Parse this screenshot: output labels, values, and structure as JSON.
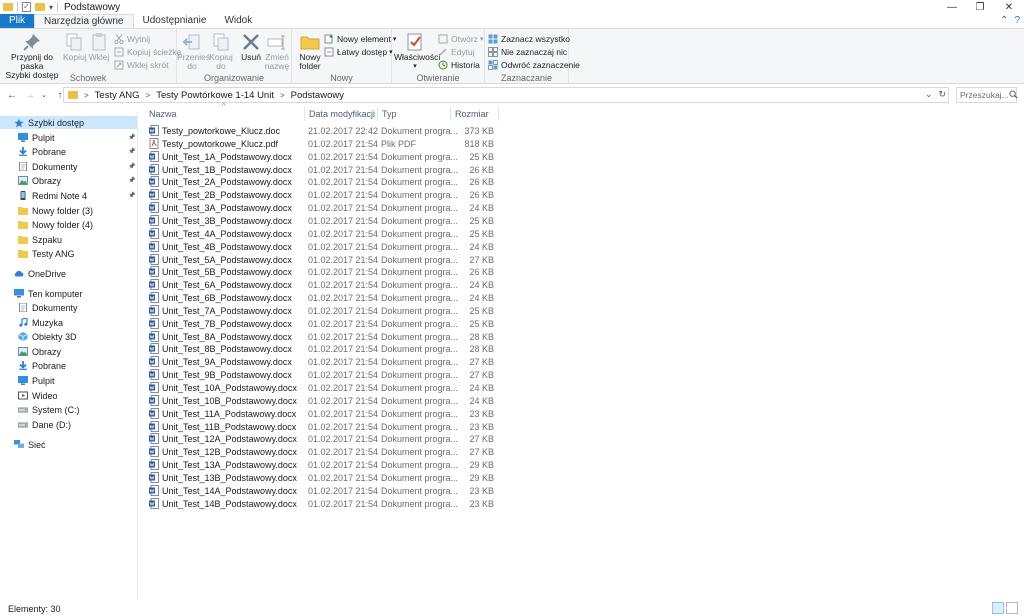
{
  "window": {
    "title": "Podstawowy",
    "minimize": "—",
    "restore": "❐",
    "close": "✕"
  },
  "tabs": [
    {
      "label": "Plik"
    },
    {
      "label": "Narzędzia główne"
    },
    {
      "label": "Udostępnianie"
    },
    {
      "label": "Widok"
    }
  ],
  "ribbon": {
    "schowek": {
      "label": "Schowek",
      "pin_line1": "Przypnij do paska",
      "pin_line2": "Szybki dostęp",
      "copy": "Kopiuj",
      "paste": "Wklej",
      "cut": "Wytnij",
      "copy_path": "Kopiuj ścieżkę",
      "paste_shortcut": "Wklej skrót"
    },
    "organizowanie": {
      "label": "Organizowanie",
      "move_line1": "Przenieś",
      "move_line2": "do",
      "copyto_line1": "Kopiuj",
      "copyto_line2": "do",
      "delete": "Usuń",
      "rename_line1": "Zmień",
      "rename_line2": "nazwę"
    },
    "nowy": {
      "label": "Nowy",
      "folder_line1": "Nowy",
      "folder_line2": "folder",
      "new_item": "Nowy element",
      "easy_access": "Łatwy dostęp"
    },
    "otwieranie": {
      "label": "Otwieranie",
      "properties": "Właściwości",
      "open": "Otwórz",
      "edit": "Edytuj",
      "history": "Historia"
    },
    "zaznaczanie": {
      "label": "Zaznaczanie",
      "select_all": "Zaznacz wszystko",
      "select_none": "Nie zaznaczaj nic",
      "invert": "Odwróć zaznaczenie"
    }
  },
  "address": {
    "crumbs": [
      "Testy ANG",
      "Testy Powtórkowe 1-14 Unit",
      "Podstawowy"
    ],
    "search_placeholder": "Przeszukaj..."
  },
  "nav": [
    {
      "label": "Szybki dostęp",
      "icon": "star-icon",
      "pinned": false
    },
    {
      "label": "Pulpit",
      "icon": "desktop-icon",
      "pinned": true
    },
    {
      "label": "Pobrane",
      "icon": "download-icon",
      "pinned": true
    },
    {
      "label": "Dokumenty",
      "icon": "documents-icon",
      "pinned": true
    },
    {
      "label": "Obrazy",
      "icon": "pictures-icon",
      "pinned": true
    },
    {
      "label": "Redmi Note 4",
      "icon": "phone-icon",
      "pinned": true
    },
    {
      "label": "Nowy folder (3)",
      "icon": "folder-icon",
      "pinned": false
    },
    {
      "label": "Nowy folder (4)",
      "icon": "folder-icon",
      "pinned": false
    },
    {
      "label": "Szpaku",
      "icon": "folder-icon",
      "pinned": false
    },
    {
      "label": "Testy ANG",
      "icon": "folder-icon",
      "pinned": false
    },
    {
      "label": "OneDrive",
      "icon": "cloud-icon",
      "pinned": false
    },
    {
      "label": "Ten komputer",
      "icon": "computer-icon",
      "pinned": false
    },
    {
      "label": "Dokumenty",
      "icon": "documents-icon",
      "pinned": false
    },
    {
      "label": "Muzyka",
      "icon": "music-icon",
      "pinned": false
    },
    {
      "label": "Obiekty 3D",
      "icon": "cube-icon",
      "pinned": false
    },
    {
      "label": "Obrazy",
      "icon": "pictures-icon",
      "pinned": false
    },
    {
      "label": "Pobrane",
      "icon": "download-icon",
      "pinned": false
    },
    {
      "label": "Pulpit",
      "icon": "desktop-icon",
      "pinned": false
    },
    {
      "label": "Wideo",
      "icon": "video-icon",
      "pinned": false
    },
    {
      "label": "System (C:)",
      "icon": "drive-icon",
      "pinned": false
    },
    {
      "label": "Dane (D:)",
      "icon": "drive-icon",
      "pinned": false
    },
    {
      "label": "Sieć",
      "icon": "network-icon",
      "pinned": false
    }
  ],
  "columns": {
    "name": "Nazwa",
    "date": "Data modyfikacji",
    "type": "Typ",
    "size": "Rozmiar"
  },
  "files": [
    {
      "name": "Testy_powtorkowe_Klucz.doc",
      "date": "21.02.2017 22:42",
      "type": "Dokument progra...",
      "size": "373 KB",
      "icon": "word-icon"
    },
    {
      "name": "Testy_powtorkowe_Klucz.pdf",
      "date": "01.02.2017 21:54",
      "type": "Plik PDF",
      "size": "818 KB",
      "icon": "pdf-icon"
    },
    {
      "name": "Unit_Test_1A_Podstawowy.docx",
      "date": "01.02.2017 21:54",
      "type": "Dokument progra...",
      "size": "25 KB",
      "icon": "word-icon"
    },
    {
      "name": "Unit_Test_1B_Podstawowy.docx",
      "date": "01.02.2017 21:54",
      "type": "Dokument progra...",
      "size": "26 KB",
      "icon": "word-icon"
    },
    {
      "name": "Unit_Test_2A_Podstawowy.docx",
      "date": "01.02.2017 21:54",
      "type": "Dokument progra...",
      "size": "26 KB",
      "icon": "word-icon"
    },
    {
      "name": "Unit_Test_2B_Podstawowy.docx",
      "date": "01.02.2017 21:54",
      "type": "Dokument progra...",
      "size": "26 KB",
      "icon": "word-icon"
    },
    {
      "name": "Unit_Test_3A_Podstawowy.docx",
      "date": "01.02.2017 21:54",
      "type": "Dokument progra...",
      "size": "24 KB",
      "icon": "word-icon"
    },
    {
      "name": "Unit_Test_3B_Podstawowy.docx",
      "date": "01.02.2017 21:54",
      "type": "Dokument progra...",
      "size": "25 KB",
      "icon": "word-icon"
    },
    {
      "name": "Unit_Test_4A_Podstawowy.docx",
      "date": "01.02.2017 21:54",
      "type": "Dokument progra...",
      "size": "25 KB",
      "icon": "word-icon"
    },
    {
      "name": "Unit_Test_4B_Podstawowy.docx",
      "date": "01.02.2017 21:54",
      "type": "Dokument progra...",
      "size": "24 KB",
      "icon": "word-icon"
    },
    {
      "name": "Unit_Test_5A_Podstawowy.docx",
      "date": "01.02.2017 21:54",
      "type": "Dokument progra...",
      "size": "27 KB",
      "icon": "word-icon"
    },
    {
      "name": "Unit_Test_5B_Podstawowy.docx",
      "date": "01.02.2017 21:54",
      "type": "Dokument progra...",
      "size": "26 KB",
      "icon": "word-icon"
    },
    {
      "name": "Unit_Test_6A_Podstawowy.docx",
      "date": "01.02.2017 21:54",
      "type": "Dokument progra...",
      "size": "24 KB",
      "icon": "word-icon"
    },
    {
      "name": "Unit_Test_6B_Podstawowy.docx",
      "date": "01.02.2017 21:54",
      "type": "Dokument progra...",
      "size": "24 KB",
      "icon": "word-icon"
    },
    {
      "name": "Unit_Test_7A_Podstawowy.docx",
      "date": "01.02.2017 21:54",
      "type": "Dokument progra...",
      "size": "25 KB",
      "icon": "word-icon"
    },
    {
      "name": "Unit_Test_7B_Podstawowy.docx",
      "date": "01.02.2017 21:54",
      "type": "Dokument progra...",
      "size": "25 KB",
      "icon": "word-icon"
    },
    {
      "name": "Unit_Test_8A_Podstawowy.docx",
      "date": "01.02.2017 21:54",
      "type": "Dokument progra...",
      "size": "28 KB",
      "icon": "word-icon"
    },
    {
      "name": "Unit_Test_8B_Podstawowy.docx",
      "date": "01.02.2017 21:54",
      "type": "Dokument progra...",
      "size": "28 KB",
      "icon": "word-icon"
    },
    {
      "name": "Unit_Test_9A_Podstawowy.docx",
      "date": "01.02.2017 21:54",
      "type": "Dokument progra...",
      "size": "27 KB",
      "icon": "word-icon"
    },
    {
      "name": "Unit_Test_9B_Podstawowy.docx",
      "date": "01.02.2017 21:54",
      "type": "Dokument progra...",
      "size": "27 KB",
      "icon": "word-icon"
    },
    {
      "name": "Unit_Test_10A_Podstawowy.docx",
      "date": "01.02.2017 21:54",
      "type": "Dokument progra...",
      "size": "24 KB",
      "icon": "word-icon"
    },
    {
      "name": "Unit_Test_10B_Podstawowy.docx",
      "date": "01.02.2017 21:54",
      "type": "Dokument progra...",
      "size": "24 KB",
      "icon": "word-icon"
    },
    {
      "name": "Unit_Test_11A_Podstawowy.docx",
      "date": "01.02.2017 21:54",
      "type": "Dokument progra...",
      "size": "23 KB",
      "icon": "word-icon"
    },
    {
      "name": "Unit_Test_11B_Podstawowy.docx",
      "date": "01.02.2017 21:54",
      "type": "Dokument progra...",
      "size": "23 KB",
      "icon": "word-icon"
    },
    {
      "name": "Unit_Test_12A_Podstawowy.docx",
      "date": "01.02.2017 21:54",
      "type": "Dokument progra...",
      "size": "27 KB",
      "icon": "word-icon"
    },
    {
      "name": "Unit_Test_12B_Podstawowy.docx",
      "date": "01.02.2017 21:54",
      "type": "Dokument progra...",
      "size": "27 KB",
      "icon": "word-icon"
    },
    {
      "name": "Unit_Test_13A_Podstawowy.docx",
      "date": "01.02.2017 21:54",
      "type": "Dokument progra...",
      "size": "29 KB",
      "icon": "word-icon"
    },
    {
      "name": "Unit_Test_13B_Podstawowy.docx",
      "date": "01.02.2017 21:54",
      "type": "Dokument progra...",
      "size": "29 KB",
      "icon": "word-icon"
    },
    {
      "name": "Unit_Test_14A_Podstawowy.docx",
      "date": "01.02.2017 21:54",
      "type": "Dokument progra...",
      "size": "23 KB",
      "icon": "word-icon"
    },
    {
      "name": "Unit_Test_14B_Podstawowy.docx",
      "date": "01.02.2017 21:54",
      "type": "Dokument progra...",
      "size": "23 KB",
      "icon": "word-icon"
    }
  ],
  "status": {
    "count": "Elementy: 30"
  },
  "colors": {
    "accent": "#1979ca",
    "selection": "#cce8ff",
    "folder": "#e8c04a",
    "word": "#2b579a",
    "pdf": "#c8342c"
  }
}
